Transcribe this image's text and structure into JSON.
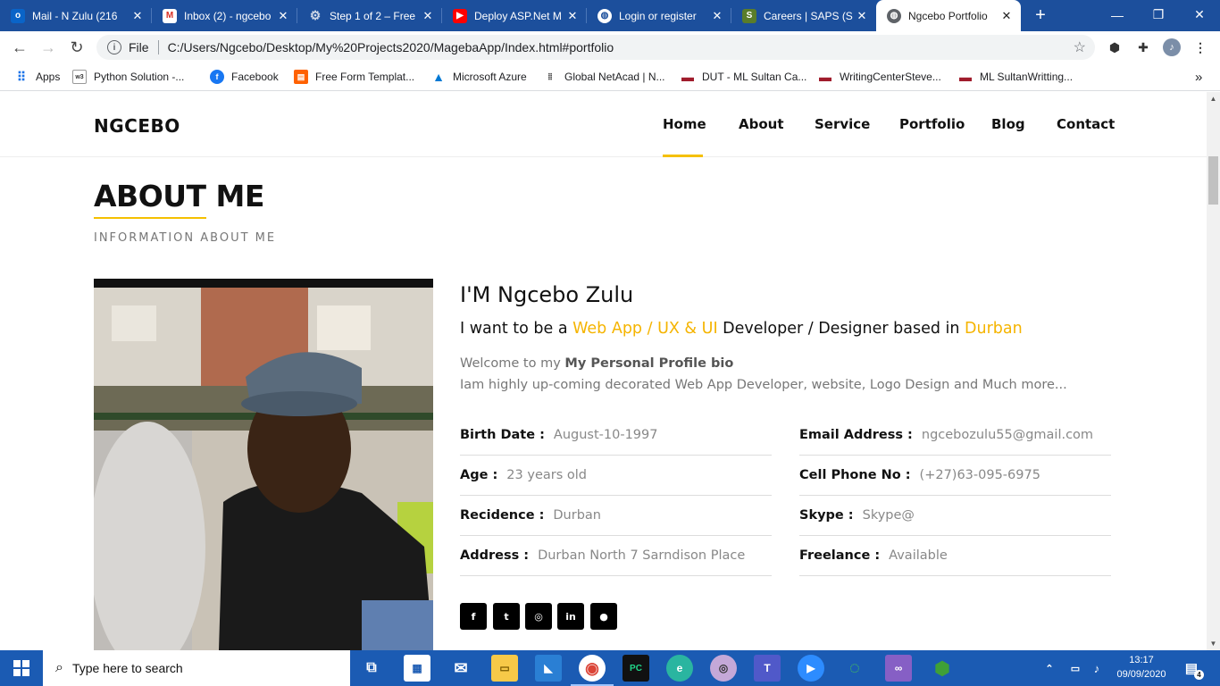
{
  "browser": {
    "tabs": [
      {
        "title": "Mail - N Zulu (216",
        "icon": "outlook-icon"
      },
      {
        "title": "Inbox (2) - ngcebo",
        "icon": "gmail-icon"
      },
      {
        "title": "Step 1 of 2 – Free",
        "icon": "settings-icon"
      },
      {
        "title": "Deploy ASP.Net M",
        "icon": "youtube-icon"
      },
      {
        "title": "Login or register",
        "icon": "globe-icon"
      },
      {
        "title": "Careers | SAPS (So",
        "icon": "saps-icon"
      },
      {
        "title": "Ngcebo Portfolio",
        "icon": "globe-icon",
        "active": true
      }
    ],
    "new_tab_label": "+",
    "address": {
      "scheme_label": "File",
      "url": "C:/Users/Ngcebo/Desktop/My%20Projects2020/MagebaApp/Index.html#portfolio"
    },
    "bookmarks": [
      {
        "label": "Apps",
        "icon": "apps-grid-icon"
      },
      {
        "label": "Python  Solution -...",
        "icon": "w3schools-icon"
      },
      {
        "label": "Facebook",
        "icon": "facebook-icon"
      },
      {
        "label": "Free Form Templat...",
        "icon": "form-icon"
      },
      {
        "label": "Microsoft Azure",
        "icon": "azure-icon"
      },
      {
        "label": "Global NetAcad  | N...",
        "icon": "cisco-icon"
      },
      {
        "label": "DUT - ML Sultan Ca...",
        "icon": "dut-icon"
      },
      {
        "label": "WritingCenterSteve...",
        "icon": "dut-icon"
      },
      {
        "label": "ML SultanWritting...",
        "icon": "dut-icon"
      }
    ],
    "bookmarks_overflow": "»"
  },
  "site": {
    "brand": "NGCEBO",
    "nav": [
      "Home",
      "About",
      "Service",
      "Portfolio",
      "Blog",
      "Contact"
    ],
    "active_nav": "Home",
    "section_title": "ABOUT ME",
    "section_subtitle": "INFORMATION ABOUT ME",
    "heading": "I'M Ngcebo Zulu",
    "tagline": {
      "pre": "I want to be a ",
      "highlight1": "Web App / UX & UI",
      "mid": " Developer / Designer based in ",
      "highlight2": "Durban"
    },
    "welcome_pre": "Welcome to my ",
    "welcome_bold": "My Personal Profile bio",
    "bio": "Iam highly up-coming decorated Web App Developer, website, Logo Design and Much more...",
    "details_left": [
      {
        "label": "Birth Date :",
        "value": "August-10-1997"
      },
      {
        "label": "Age :",
        "value": "23 years old"
      },
      {
        "label": "Recidence :",
        "value": "Durban"
      },
      {
        "label": "Address :",
        "value": "Durban North 7 Sarndison Place"
      }
    ],
    "details_right": [
      {
        "label": "Email Address :",
        "value": "ngcebozulu55@gmail.com"
      },
      {
        "label": "Cell Phone No :",
        "value": "(+27)63-095-6975"
      },
      {
        "label": "Skype :",
        "value": "Skype@"
      },
      {
        "label": "Freelance :",
        "value": "Available"
      }
    ],
    "social": [
      {
        "name": "facebook",
        "glyph": "f"
      },
      {
        "name": "twitter",
        "glyph": "t"
      },
      {
        "name": "instagram",
        "glyph": "◎"
      },
      {
        "name": "linkedin",
        "glyph": "in"
      },
      {
        "name": "github",
        "glyph": "●"
      }
    ],
    "accent_color": "#f5c000"
  },
  "taskbar": {
    "search_placeholder": "Type here to search",
    "time": "13:17",
    "date": "09/09/2020",
    "notification_count": "4"
  }
}
